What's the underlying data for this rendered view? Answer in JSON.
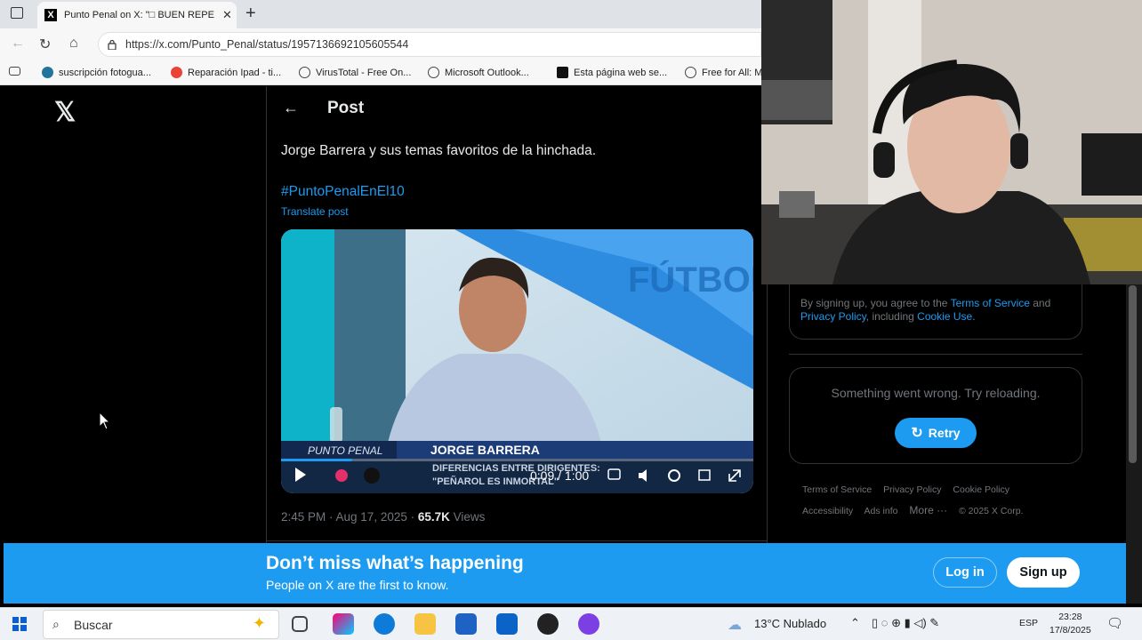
{
  "browser": {
    "tab_title": "Punto Penal on X: \"□ BUEN REPE",
    "url": "https://x.com/Punto_Penal/status/1957136692105605544",
    "bookmarks": [
      "suscripción fotogua...",
      "Reparación Ipad - ti...",
      "VirusTotal - Free On...",
      "Microsoft Outlook...",
      "Esta página web se...",
      "Free for All: M"
    ]
  },
  "post": {
    "header": "Post",
    "text": "Jorge Barrera y sus temas favoritos de la hinchada.",
    "hashtag": "#PuntoPenalEnEl10",
    "translate": "Translate post",
    "timestamp": "2:45 PM · Aug 17, 2025 · ",
    "views_count": "65.7K",
    "views_label": " Views"
  },
  "video": {
    "brand_bg": "FÚTBOL",
    "lower_third_brand": "PUNTO PENAL",
    "name": "JORGE BARRERA",
    "caption_line1": "DIFERENCIAS ENTRE DIRIGENTES:",
    "caption_line2": "\"PEÑAROL ES INMORTAL\"",
    "time": "0:09 / 1:00",
    "progress": 0.15
  },
  "sidebar": {
    "terms_prefix": "By signing up, you agree to the ",
    "terms_link": "Terms of Service",
    "terms_and": " and ",
    "privacy_link": "Privacy Policy",
    "including": ", including ",
    "cookie_link": "Cookie Use.",
    "error_message": "Something went wrong. Try reloading.",
    "retry": "Retry",
    "footer": [
      "Terms of Service",
      "Privacy Policy",
      "Cookie Policy",
      "Accessibility",
      "Ads info",
      "More ···",
      "© 2025 X Corp."
    ]
  },
  "banner": {
    "title": "Don’t miss what’s happening",
    "subtitle": "People on X are the first to know.",
    "login": "Log in",
    "signup": "Sign up"
  },
  "taskbar": {
    "search": "Buscar",
    "weather": "13°C  Nublado",
    "lang": "ESP",
    "time": "23:28",
    "date": "17/8/2025"
  },
  "colors": {
    "x_blue": "#1d9bf0",
    "bg": "#000000",
    "border": "#2f3336"
  }
}
